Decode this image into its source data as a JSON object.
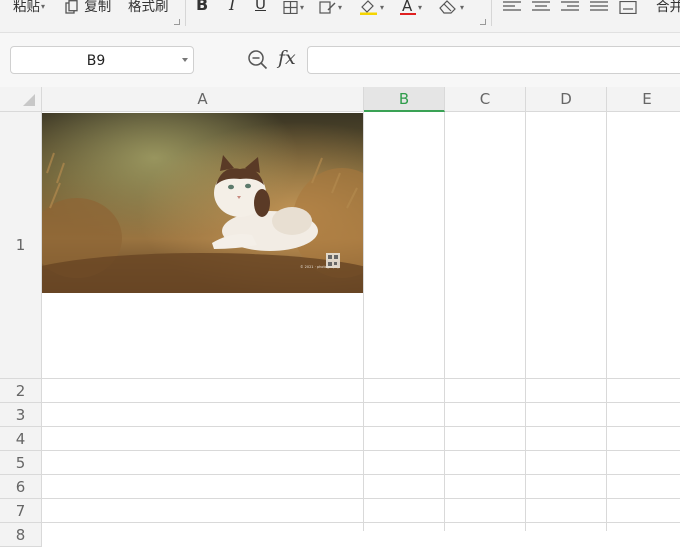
{
  "toolbar": {
    "paste_label": "粘贴",
    "copy_label": "复制",
    "format_painter_label": "格式刷",
    "bold_label": "B",
    "italic_label": "I",
    "underline_label": "U",
    "font_color_label": "A",
    "merge_label": "合并",
    "highlight_color": "#f5d500",
    "font_color": "#e02020"
  },
  "formula_bar": {
    "name_box": "B9",
    "fx_label": "fx",
    "formula": ""
  },
  "sheet": {
    "columns": [
      "A",
      "B",
      "C",
      "D",
      "E"
    ],
    "rows": [
      "1",
      "2",
      "3",
      "4",
      "5",
      "6",
      "7",
      "8"
    ],
    "selected_column": "B",
    "accent_color": "#3aa255"
  },
  "image": {
    "caption": "© 2021 · photography"
  }
}
